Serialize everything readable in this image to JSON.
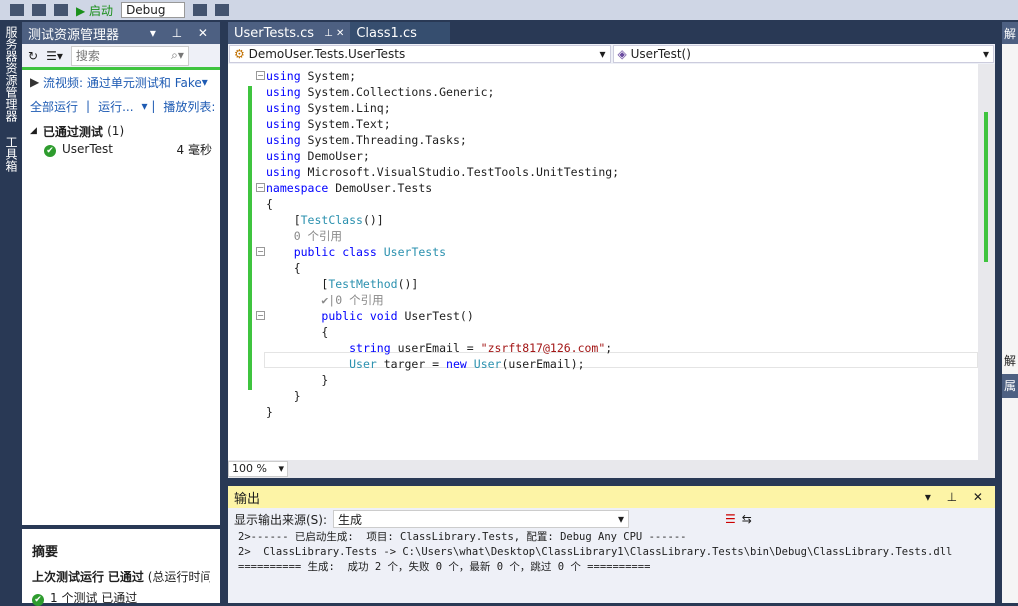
{
  "toolbar": {
    "start_label": "启动",
    "config": "Debug"
  },
  "left_strip": [
    "服务器资源管理器",
    "工具箱"
  ],
  "test_explorer": {
    "title": "测试资源管理器",
    "search_placeholder": "搜索",
    "video_link": "流视频: 通过单元测试和 Fake",
    "run_all": "全部运行",
    "run": "运行...",
    "playlist": "播放列表:",
    "group_label": "已通过测试",
    "group_count": "(1)",
    "tests": [
      {
        "name": "UserTest",
        "duration": "4 毫秒",
        "status": "passed"
      }
    ],
    "summary": {
      "title": "摘要",
      "last_run": "上次测试运行",
      "last_run_status": "已通过",
      "run_time": "(总运行时间",
      "count_text": "1 个测试 已通过"
    }
  },
  "editor": {
    "tabs": [
      {
        "label": "UserTests.cs",
        "active": true
      },
      {
        "label": "Class1.cs",
        "active": false
      }
    ],
    "nav_class": "DemoUser.Tests.UserTests",
    "nav_member": "UserTest()",
    "zoom": "100 %",
    "lines": [
      [
        [
          "using",
          "k"
        ],
        [
          " System;",
          "p"
        ]
      ],
      [
        [
          "using",
          "k"
        ],
        [
          " System.Collections.Generic;",
          "p"
        ]
      ],
      [
        [
          "using",
          "k"
        ],
        [
          " System.Linq;",
          "p"
        ]
      ],
      [
        [
          "using",
          "k"
        ],
        [
          " System.Text;",
          "p"
        ]
      ],
      [
        [
          "using",
          "k"
        ],
        [
          " System.Threading.Tasks;",
          "p"
        ]
      ],
      [
        [
          "using",
          "k"
        ],
        [
          " DemoUser;",
          "p"
        ]
      ],
      [
        [
          "using",
          "k"
        ],
        [
          " Microsoft.VisualStudio.TestTools.UnitTesting;",
          "p"
        ]
      ],
      [
        [
          "namespace",
          "k"
        ],
        [
          " DemoUser.Tests",
          "p"
        ]
      ],
      [
        [
          "{",
          "p"
        ]
      ],
      [
        [
          "    [",
          "p"
        ],
        [
          "TestClass",
          "t"
        ],
        [
          "()]",
          "p"
        ]
      ],
      [
        [
          "    0 个引用",
          "r"
        ]
      ],
      [
        [
          "    ",
          "p"
        ],
        [
          "public",
          "k"
        ],
        [
          " ",
          "p"
        ],
        [
          "class",
          "k"
        ],
        [
          " ",
          "p"
        ],
        [
          "UserTests",
          "t"
        ]
      ],
      [
        [
          "    {",
          "p"
        ]
      ],
      [
        [
          "        [",
          "p"
        ],
        [
          "TestMethod",
          "t"
        ],
        [
          "()]",
          "p"
        ]
      ],
      [
        [
          "        ✔|0 个引用",
          "r"
        ]
      ],
      [
        [
          "        ",
          "p"
        ],
        [
          "public",
          "k"
        ],
        [
          " ",
          "p"
        ],
        [
          "void",
          "k"
        ],
        [
          " UserTest()",
          "p"
        ]
      ],
      [
        [
          "        {",
          "p"
        ]
      ],
      [
        [
          "            ",
          "p"
        ],
        [
          "string",
          "k"
        ],
        [
          " userEmail = ",
          "p"
        ],
        [
          "\"zsrft817@126.com\"",
          "s"
        ],
        [
          ";",
          "p"
        ]
      ],
      [
        [
          "            ",
          "p"
        ],
        [
          "User",
          "t"
        ],
        [
          " targer = ",
          "p"
        ],
        [
          "new",
          "k"
        ],
        [
          " ",
          "p"
        ],
        [
          "User",
          "t"
        ],
        [
          "(userEmail);",
          "p"
        ]
      ],
      [
        [
          "        }",
          "p"
        ]
      ],
      [
        [
          "    }",
          "p"
        ]
      ],
      [
        [
          "}",
          "p"
        ]
      ]
    ]
  },
  "output": {
    "title": "输出",
    "source_label": "显示输出来源(S):",
    "source_value": "生成",
    "lines": [
      "2>------ 已启动生成:  项目: ClassLibrary.Tests, 配置: Debug Any CPU ------",
      "2>  ClassLibrary.Tests -> C:\\Users\\what\\Desktop\\ClassLibrary1\\ClassLibrary.Tests\\bin\\Debug\\ClassLibrary.Tests.dll",
      "========== 生成:  成功 2 个，失败 0 个，最新 0 个，跳过 0 个 =========="
    ]
  },
  "right_panel": {
    "title": "解",
    "label2": "属"
  },
  "colors": {
    "theme": "#293955",
    "pass": "#2e9c2e",
    "keyword": "#0000ff",
    "type": "#2b91af",
    "string": "#a31515"
  }
}
